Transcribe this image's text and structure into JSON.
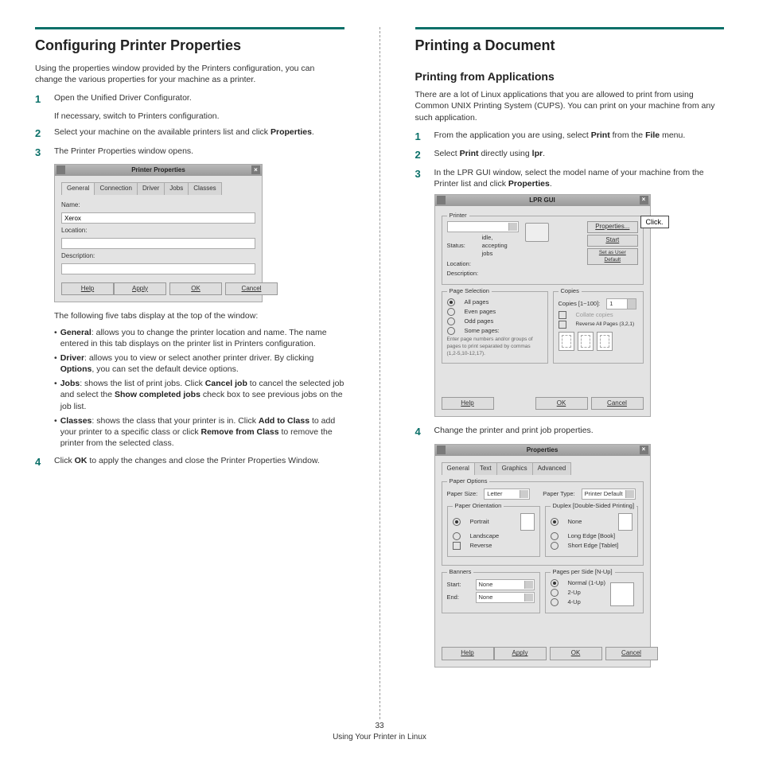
{
  "left": {
    "h1": "Configuring Printer Properties",
    "intro": "Using the properties window provided by the Printers configuration, you can change the various properties for your machine as a printer.",
    "s1": "Open the Unified Driver Configurator.",
    "s1a": "If necessary, switch to Printers configuration.",
    "s2a": "Select your machine on the available printers list and click ",
    "s2b": "Properties",
    "s3": "The Printer Properties window opens.",
    "win": {
      "title": "Printer Properties",
      "tabs": [
        "General",
        "Connection",
        "Driver",
        "Jobs",
        "Classes"
      ],
      "name_lbl": "Name:",
      "name": "Xerox",
      "loc_lbl": "Location:",
      "desc_lbl": "Description:",
      "help": "Help",
      "apply": "Apply",
      "ok": "OK",
      "cancel": "Cancel"
    },
    "after": "The following five tabs display at the top of the window:",
    "b1a": "General",
    "b1b": ": allows you to change the printer location and name. The name entered in this tab displays on the printer list in Printers configuration.",
    "b2a": "Driver",
    "b2b": ": allows you to view or select another printer driver. By clicking ",
    "b2c": "Options",
    "b2d": ", you can set the default device options.",
    "b3a": "Jobs",
    "b3b": ": shows the list of print jobs. Click ",
    "b3c": "Cancel job",
    "b3d": " to cancel the selected job and select the ",
    "b3e": "Show completed jobs",
    "b3f": " check box to see previous jobs on the job list.",
    "b4a": "Classes",
    "b4b": ": shows the class that your printer is in. Click ",
    "b4c": "Add to Class",
    "b4d": " to add your printer to a specific class or click ",
    "b4e": "Remove from Class",
    "b4f": " to remove the printer from the selected class.",
    "s4a": "Click ",
    "s4b": "OK",
    "s4c": " to apply the changes and close the Printer Properties Window."
  },
  "right": {
    "h1": "Printing a Document",
    "h2": "Printing from Applications",
    "intro": "There are a lot of Linux applications that you are allowed to print from using Common UNIX Printing System (CUPS). You can print on your machine from any such application.",
    "s1a": "From the application you are using, select ",
    "s1b": "Print",
    "s1c": " from the ",
    "s1d": "File",
    "s1e": " menu.",
    "s2a": "Select ",
    "s2b": "Print",
    "s2c": " directly using ",
    "s2d": "lpr",
    "s3a": "In the LPR GUI window, select the model name of your machine from the Printer list and click ",
    "s3b": "Properties",
    "lpr": {
      "title": "LPR GUI",
      "printer": "Printer",
      "status_lbl": "Status:",
      "status": "idle, accepting jobs",
      "loc_lbl": "Location:",
      "desc_lbl": "Description:",
      "props": "Properties...",
      "start": "Start",
      "setdef": "Set as User Default",
      "pagesel": "Page Selection",
      "all": "All pages",
      "even": "Even pages",
      "odd": "Odd pages",
      "some": "Some pages:",
      "hint": "Enter page numbers and/or groups of pages to print separated by commas (1,2-5,10-12,17).",
      "copies": "Copies",
      "cop_lbl": "Copies [1~100]:",
      "cop_val": "1",
      "collate": "Collate copies",
      "reverse": "Reverse All Pages (3,2,1)",
      "help": "Help",
      "ok": "OK",
      "cancel": "Cancel"
    },
    "callout": "Click.",
    "s4": "Change the printer and print job properties.",
    "props": {
      "title": "Properties",
      "tabs": [
        "General",
        "Text",
        "Graphics",
        "Advanced"
      ],
      "paperopt": "Paper Options",
      "psize_lbl": "Paper Size:",
      "psize": "Letter",
      "ptype_lbl": "Paper Type:",
      "ptype": "Printer Default",
      "orient": "Paper Orientation",
      "portrait": "Portrait",
      "landscape": "Landscape",
      "rev": "Reverse",
      "duplex": "Duplex [Double-Sided Printing]",
      "none": "None",
      "long": "Long Edge [Book]",
      "short": "Short Edge [Tablet]",
      "banners": "Banners",
      "start_lbl": "Start:",
      "start": "None",
      "end_lbl": "End:",
      "end": "None",
      "nup": "Pages per Side [N-Up]",
      "n1": "Normal (1-Up)",
      "n2": "2-Up",
      "n4": "4-Up",
      "help": "Help",
      "apply": "Apply",
      "ok": "OK",
      "cancel": "Cancel"
    }
  },
  "page_num": "33",
  "footer": "Using Your Printer in Linux"
}
